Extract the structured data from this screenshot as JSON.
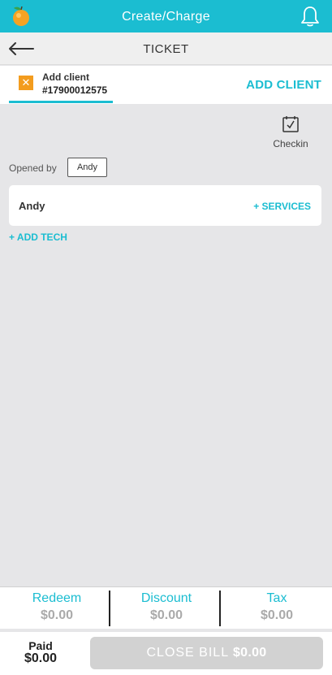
{
  "header": {
    "title": "Create/Charge"
  },
  "subheader": {
    "title": "TICKET"
  },
  "client": {
    "name": "Add client",
    "phone": "#17900012575",
    "add_label": "ADD CLIENT"
  },
  "checkin": {
    "label": "Checkin"
  },
  "opened_by": {
    "label": "Opened by",
    "value": "Andy"
  },
  "tech": {
    "name": "Andy",
    "add_services_label": "+ SERVICES"
  },
  "add_tech_label": "+ ADD TECH",
  "totals": [
    {
      "label": "Redeem",
      "value": "$0.00"
    },
    {
      "label": "Discount",
      "value": "$0.00"
    },
    {
      "label": "Tax",
      "value": "$0.00"
    }
  ],
  "footer": {
    "paid_label": "Paid",
    "paid_value": "$0.00",
    "close_bill_label": "CLOSE BILL",
    "close_bill_amount": "$0.00"
  },
  "colors": {
    "accent": "#1bbdd1",
    "client_badge": "#f39c1e",
    "disabled": "#d2d2d2"
  }
}
